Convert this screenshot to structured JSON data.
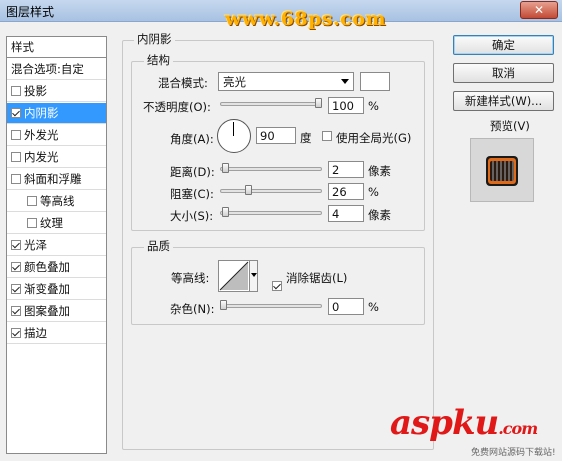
{
  "window": {
    "title": "图层样式",
    "close_label": "✕",
    "watermark_top": "www.68ps.com"
  },
  "styles_list": {
    "header": "样式",
    "blend_options": "混合选项:自定",
    "items": [
      {
        "label": "投影",
        "checked": false
      },
      {
        "label": "内阴影",
        "checked": true,
        "selected": true
      },
      {
        "label": "外发光",
        "checked": false
      },
      {
        "label": "内发光",
        "checked": false
      },
      {
        "label": "斜面和浮雕",
        "checked": false
      },
      {
        "label": "等高线",
        "checked": false,
        "sub": true
      },
      {
        "label": "纹理",
        "checked": false,
        "sub": true
      },
      {
        "label": "光泽",
        "checked": true
      },
      {
        "label": "颜色叠加",
        "checked": true
      },
      {
        "label": "渐变叠加",
        "checked": true
      },
      {
        "label": "图案叠加",
        "checked": true
      },
      {
        "label": "描边",
        "checked": true
      }
    ]
  },
  "inner_shadow": {
    "section_title": "内阴影",
    "structure": {
      "title": "结构",
      "blend_mode_label": "混合模式:",
      "blend_mode_value": "亮光",
      "blend_color": "#ffffff",
      "opacity_label": "不透明度(O):",
      "opacity_value": "100",
      "opacity_unit": "%",
      "opacity_level": 1.0,
      "angle_label": "角度(A):",
      "angle_value": "90",
      "angle_unit": "度",
      "global_light_label": "使用全局光(G)",
      "global_light_checked": false,
      "distance_label": "距离(D):",
      "distance_value": "2",
      "distance_unit": "像素",
      "distance_level": 0.02,
      "choke_label": "阻塞(C):",
      "choke_value": "26",
      "choke_unit": "%",
      "choke_level": 0.26,
      "size_label": "大小(S):",
      "size_value": "4",
      "size_unit": "像素",
      "size_level": 0.02
    },
    "quality": {
      "title": "品质",
      "contour_label": "等高线:",
      "anti_alias_label": "消除锯齿(L)",
      "anti_alias_checked": true,
      "noise_label": "杂色(N):",
      "noise_value": "0",
      "noise_unit": "%",
      "noise_level": 0.0
    }
  },
  "buttons": {
    "ok": "确定",
    "cancel": "取消",
    "new_style": "新建样式(W)...",
    "preview_label": "预览(V)",
    "preview_checked": true
  },
  "watermark_bottom": {
    "text": "aspku",
    "suffix": ".com",
    "sub": "免费网站源码下载站!"
  }
}
